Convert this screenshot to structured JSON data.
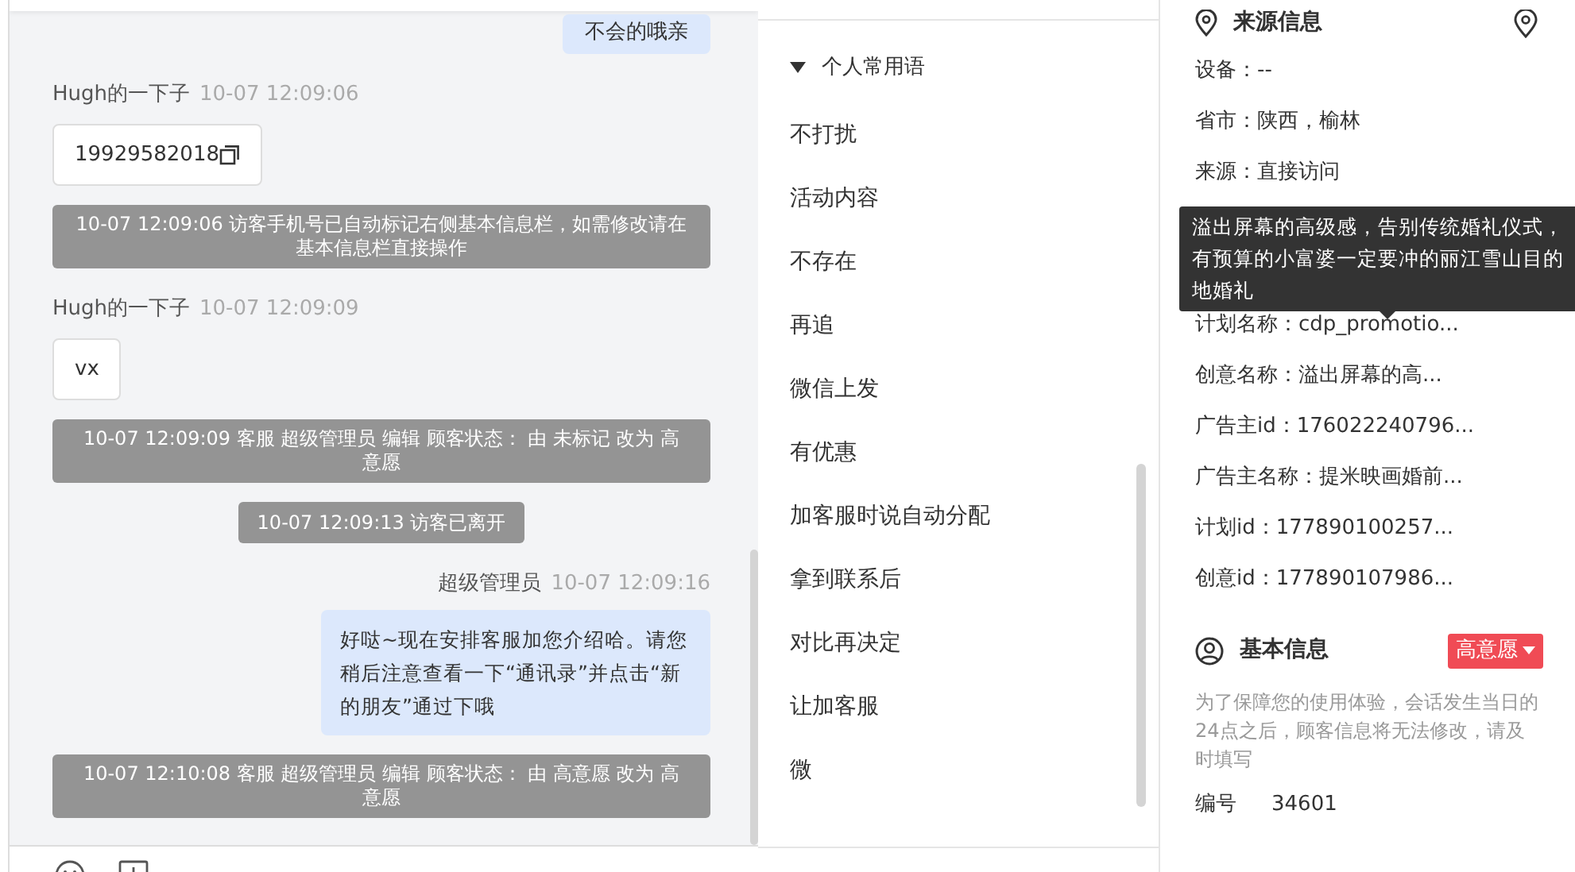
{
  "chat": {
    "messages": [
      {
        "kind": "self-bubble-tail",
        "text": "不会的哦亲"
      },
      {
        "kind": "visitor",
        "sender": "Hugh的一下子",
        "time": "10-07 12:09:06",
        "text": "19929582018",
        "copy": true
      },
      {
        "kind": "system",
        "text": "10-07 12:09:06 访客手机号已自动标记右侧基本信息栏，如需修改请在基本信息栏直接操作"
      },
      {
        "kind": "visitor",
        "sender": "Hugh的一下子",
        "time": "10-07 12:09:09",
        "text": "vx",
        "copy": false
      },
      {
        "kind": "system",
        "text": "10-07 12:09:09 客服 超级管理员 编辑 顾客状态： 由 未标记 改为 高意愿"
      },
      {
        "kind": "notice",
        "text": "10-07 12:09:13 访客已离开"
      },
      {
        "kind": "agent",
        "sender": "超级管理员",
        "time": "10-07 12:09:16",
        "text": "好哒~现在安排客服加您介绍哈。请您稍后注意查看一下“通讯录”并点击“新的朋友”通过下哦"
      },
      {
        "kind": "system",
        "text": "10-07 12:10:08 客服 超级管理员 编辑 顾客状态： 由 高意愿 改为 高意愿"
      }
    ]
  },
  "phrases": {
    "group": {
      "label": "个人常用语",
      "expanded": true
    },
    "items": [
      "不打扰",
      "活动内容",
      "不存在",
      "再追",
      "微信上发",
      "有优惠",
      "加客服时说自动分配",
      "拿到联系后",
      "对比再决定",
      "让加客服",
      "微"
    ]
  },
  "source_info": {
    "title": "来源信息",
    "rows": [
      "设备：--",
      "省市：陕西，榆林",
      "来源：直接访问",
      null,
      null,
      "计划名称：cdp_promotio...",
      "创意名称：溢出屏幕的高...",
      "广告主id：176022240796...",
      "广告主名称：提米映画婚前...",
      "计划id：177890100257...",
      "创意id：177890107986..."
    ],
    "tooltip": "溢出屏幕的高级感，告别传统婚礼仪式，有预算的小富婆一定要冲的丽江雪山目的地婚礼"
  },
  "basic_info": {
    "title": "基本信息",
    "intent_tag": "高意愿",
    "notice": "为了保障您的使用体验，会话发生当日的24点之后，顾客信息将无法修改，请及时填写",
    "fields": [
      {
        "label": "编号",
        "value": "34601"
      }
    ]
  }
}
